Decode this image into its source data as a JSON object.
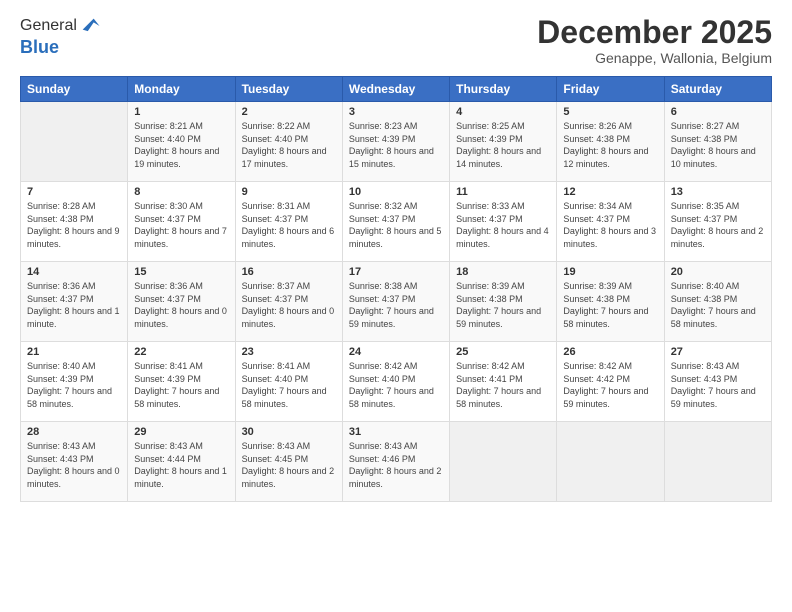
{
  "header": {
    "logo_line1": "General",
    "logo_line2": "Blue",
    "month_title": "December 2025",
    "location": "Genappe, Wallonia, Belgium"
  },
  "days_of_week": [
    "Sunday",
    "Monday",
    "Tuesday",
    "Wednesday",
    "Thursday",
    "Friday",
    "Saturday"
  ],
  "weeks": [
    [
      {
        "num": "",
        "sunrise": "",
        "sunset": "",
        "daylight": "",
        "empty": true
      },
      {
        "num": "1",
        "sunrise": "Sunrise: 8:21 AM",
        "sunset": "Sunset: 4:40 PM",
        "daylight": "Daylight: 8 hours and 19 minutes."
      },
      {
        "num": "2",
        "sunrise": "Sunrise: 8:22 AM",
        "sunset": "Sunset: 4:40 PM",
        "daylight": "Daylight: 8 hours and 17 minutes."
      },
      {
        "num": "3",
        "sunrise": "Sunrise: 8:23 AM",
        "sunset": "Sunset: 4:39 PM",
        "daylight": "Daylight: 8 hours and 15 minutes."
      },
      {
        "num": "4",
        "sunrise": "Sunrise: 8:25 AM",
        "sunset": "Sunset: 4:39 PM",
        "daylight": "Daylight: 8 hours and 14 minutes."
      },
      {
        "num": "5",
        "sunrise": "Sunrise: 8:26 AM",
        "sunset": "Sunset: 4:38 PM",
        "daylight": "Daylight: 8 hours and 12 minutes."
      },
      {
        "num": "6",
        "sunrise": "Sunrise: 8:27 AM",
        "sunset": "Sunset: 4:38 PM",
        "daylight": "Daylight: 8 hours and 10 minutes."
      }
    ],
    [
      {
        "num": "7",
        "sunrise": "Sunrise: 8:28 AM",
        "sunset": "Sunset: 4:38 PM",
        "daylight": "Daylight: 8 hours and 9 minutes."
      },
      {
        "num": "8",
        "sunrise": "Sunrise: 8:30 AM",
        "sunset": "Sunset: 4:37 PM",
        "daylight": "Daylight: 8 hours and 7 minutes."
      },
      {
        "num": "9",
        "sunrise": "Sunrise: 8:31 AM",
        "sunset": "Sunset: 4:37 PM",
        "daylight": "Daylight: 8 hours and 6 minutes."
      },
      {
        "num": "10",
        "sunrise": "Sunrise: 8:32 AM",
        "sunset": "Sunset: 4:37 PM",
        "daylight": "Daylight: 8 hours and 5 minutes."
      },
      {
        "num": "11",
        "sunrise": "Sunrise: 8:33 AM",
        "sunset": "Sunset: 4:37 PM",
        "daylight": "Daylight: 8 hours and 4 minutes."
      },
      {
        "num": "12",
        "sunrise": "Sunrise: 8:34 AM",
        "sunset": "Sunset: 4:37 PM",
        "daylight": "Daylight: 8 hours and 3 minutes."
      },
      {
        "num": "13",
        "sunrise": "Sunrise: 8:35 AM",
        "sunset": "Sunset: 4:37 PM",
        "daylight": "Daylight: 8 hours and 2 minutes."
      }
    ],
    [
      {
        "num": "14",
        "sunrise": "Sunrise: 8:36 AM",
        "sunset": "Sunset: 4:37 PM",
        "daylight": "Daylight: 8 hours and 1 minute."
      },
      {
        "num": "15",
        "sunrise": "Sunrise: 8:36 AM",
        "sunset": "Sunset: 4:37 PM",
        "daylight": "Daylight: 8 hours and 0 minutes."
      },
      {
        "num": "16",
        "sunrise": "Sunrise: 8:37 AM",
        "sunset": "Sunset: 4:37 PM",
        "daylight": "Daylight: 8 hours and 0 minutes."
      },
      {
        "num": "17",
        "sunrise": "Sunrise: 8:38 AM",
        "sunset": "Sunset: 4:37 PM",
        "daylight": "Daylight: 7 hours and 59 minutes."
      },
      {
        "num": "18",
        "sunrise": "Sunrise: 8:39 AM",
        "sunset": "Sunset: 4:38 PM",
        "daylight": "Daylight: 7 hours and 59 minutes."
      },
      {
        "num": "19",
        "sunrise": "Sunrise: 8:39 AM",
        "sunset": "Sunset: 4:38 PM",
        "daylight": "Daylight: 7 hours and 58 minutes."
      },
      {
        "num": "20",
        "sunrise": "Sunrise: 8:40 AM",
        "sunset": "Sunset: 4:38 PM",
        "daylight": "Daylight: 7 hours and 58 minutes."
      }
    ],
    [
      {
        "num": "21",
        "sunrise": "Sunrise: 8:40 AM",
        "sunset": "Sunset: 4:39 PM",
        "daylight": "Daylight: 7 hours and 58 minutes."
      },
      {
        "num": "22",
        "sunrise": "Sunrise: 8:41 AM",
        "sunset": "Sunset: 4:39 PM",
        "daylight": "Daylight: 7 hours and 58 minutes."
      },
      {
        "num": "23",
        "sunrise": "Sunrise: 8:41 AM",
        "sunset": "Sunset: 4:40 PM",
        "daylight": "Daylight: 7 hours and 58 minutes."
      },
      {
        "num": "24",
        "sunrise": "Sunrise: 8:42 AM",
        "sunset": "Sunset: 4:40 PM",
        "daylight": "Daylight: 7 hours and 58 minutes."
      },
      {
        "num": "25",
        "sunrise": "Sunrise: 8:42 AM",
        "sunset": "Sunset: 4:41 PM",
        "daylight": "Daylight: 7 hours and 58 minutes."
      },
      {
        "num": "26",
        "sunrise": "Sunrise: 8:42 AM",
        "sunset": "Sunset: 4:42 PM",
        "daylight": "Daylight: 7 hours and 59 minutes."
      },
      {
        "num": "27",
        "sunrise": "Sunrise: 8:43 AM",
        "sunset": "Sunset: 4:43 PM",
        "daylight": "Daylight: 7 hours and 59 minutes."
      }
    ],
    [
      {
        "num": "28",
        "sunrise": "Sunrise: 8:43 AM",
        "sunset": "Sunset: 4:43 PM",
        "daylight": "Daylight: 8 hours and 0 minutes."
      },
      {
        "num": "29",
        "sunrise": "Sunrise: 8:43 AM",
        "sunset": "Sunset: 4:44 PM",
        "daylight": "Daylight: 8 hours and 1 minute."
      },
      {
        "num": "30",
        "sunrise": "Sunrise: 8:43 AM",
        "sunset": "Sunset: 4:45 PM",
        "daylight": "Daylight: 8 hours and 2 minutes."
      },
      {
        "num": "31",
        "sunrise": "Sunrise: 8:43 AM",
        "sunset": "Sunset: 4:46 PM",
        "daylight": "Daylight: 8 hours and 2 minutes."
      },
      {
        "num": "",
        "sunrise": "",
        "sunset": "",
        "daylight": "",
        "empty": true
      },
      {
        "num": "",
        "sunrise": "",
        "sunset": "",
        "daylight": "",
        "empty": true
      },
      {
        "num": "",
        "sunrise": "",
        "sunset": "",
        "daylight": "",
        "empty": true
      }
    ]
  ]
}
